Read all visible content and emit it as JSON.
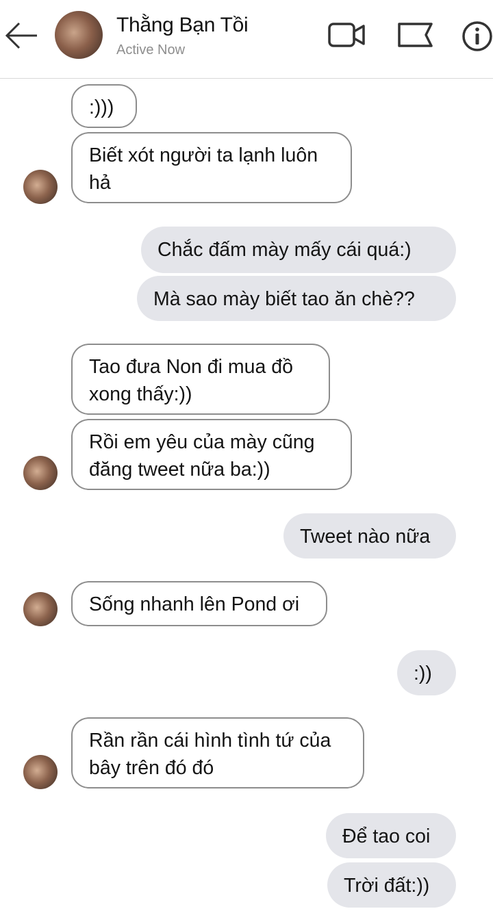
{
  "header": {
    "contact_name": "Thằng Bạn Tồi",
    "status": "Active Now",
    "icons": [
      "back-arrow-icon",
      "video-call-icon",
      "flag-icon",
      "info-icon"
    ]
  },
  "messages": [
    {
      "side": "in",
      "text": ":)))"
    },
    {
      "side": "in",
      "text": "Biết xót người ta lạnh luôn\nhả"
    },
    {
      "side": "out",
      "text": "Chắc đấm mày mấy cái quá:)"
    },
    {
      "side": "out",
      "text": "Mà sao mày biết tao ăn chè??"
    },
    {
      "side": "in",
      "text": "Tao đưa Non đi mua đồ\nxong thấy:))"
    },
    {
      "side": "in",
      "text": "Rồi em yêu của mày cũng\nđăng tweet nữa ba:))"
    },
    {
      "side": "out",
      "text": "Tweet nào nữa"
    },
    {
      "side": "in",
      "text": "Sống nhanh lên Pond ơi"
    },
    {
      "side": "out",
      "text": ":))"
    },
    {
      "side": "in",
      "text": "Rần rần cái hình tình tứ của\nbây trên đó đó"
    },
    {
      "side": "out",
      "text": "Để tao coi"
    },
    {
      "side": "out",
      "text": "Trời đất:))"
    }
  ],
  "colors": {
    "incoming_border": "#8d8d8d",
    "outgoing_bg": "#e4e5ea",
    "status_text": "#8e8e8e"
  }
}
